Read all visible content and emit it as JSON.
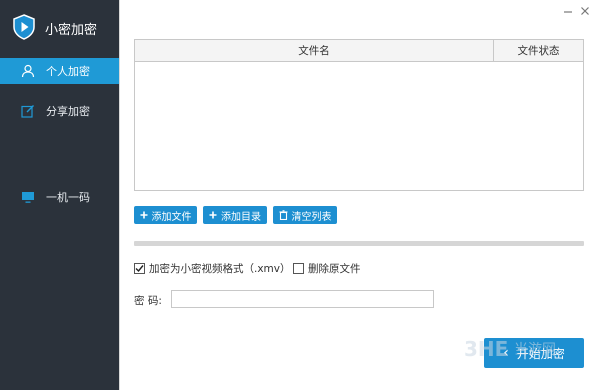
{
  "app": {
    "title": "小密加密",
    "brand_color": "#1d8fd1",
    "sidebar_color": "#2b323b"
  },
  "sidebar": {
    "items": [
      {
        "label": "个人加密",
        "icon": "user-icon",
        "active": true
      },
      {
        "label": "分享加密",
        "icon": "share-edit-icon",
        "active": false
      },
      {
        "label": "一机一码",
        "icon": "monitor-icon",
        "active": false
      }
    ]
  },
  "window": {
    "minimize_icon": "minimize-icon",
    "close_icon": "close-icon"
  },
  "file_table": {
    "columns": [
      "文件名",
      "文件状态"
    ],
    "rows": []
  },
  "actions": {
    "add_file": "添加文件",
    "add_dir": "添加目录",
    "clear_list": "清空列表"
  },
  "progress": {
    "value": 0
  },
  "options": {
    "encrypt_xmv": {
      "label": "加密为小密视频格式（.xmv）",
      "checked": true
    },
    "delete_source": {
      "label": "删除原文件",
      "checked": false
    }
  },
  "password": {
    "label": "密 码:",
    "value": ""
  },
  "start_button": {
    "label": "开始加密",
    "icon": "chevron-left-icon"
  },
  "watermark": {
    "text": "3HE 当游网"
  }
}
